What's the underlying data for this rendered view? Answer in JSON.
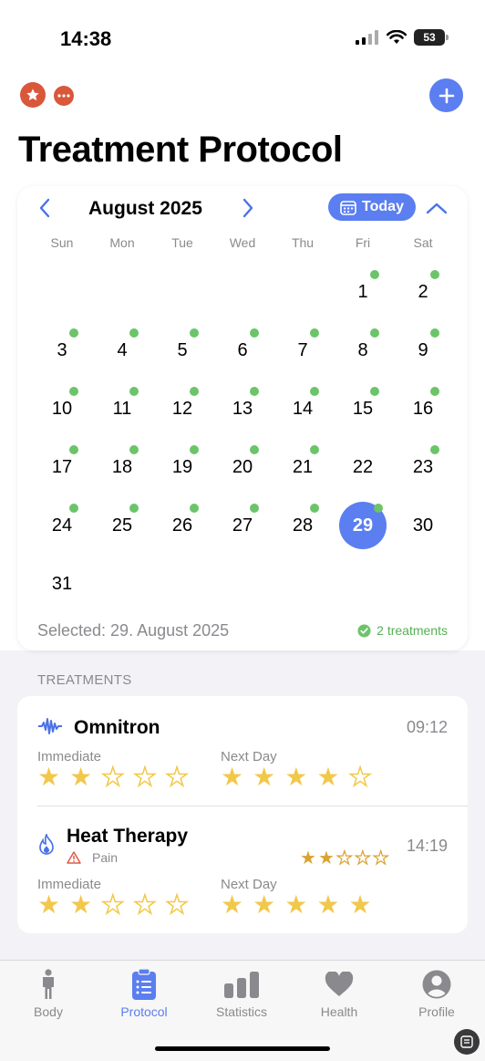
{
  "status_bar": {
    "time": "14:38",
    "battery": "53"
  },
  "header": {
    "title": "Treatment Protocol"
  },
  "calendar": {
    "month": "August 2025",
    "today_label": "Today",
    "weekdays": [
      "Sun",
      "Mon",
      "Tue",
      "Wed",
      "Thu",
      "Fri",
      "Sat"
    ],
    "first_weekday_index": 5,
    "days_in_month": 31,
    "selected_day": 29,
    "days_with_entries": [
      1,
      2,
      3,
      4,
      5,
      6,
      7,
      8,
      9,
      10,
      11,
      12,
      13,
      14,
      15,
      16,
      17,
      18,
      19,
      20,
      21,
      23,
      24,
      25,
      26,
      27,
      28,
      29
    ],
    "selected_text": "Selected: 29. August 2025",
    "treatment_count": "2 treatments",
    "accent_color": "#5b7ef0",
    "entry_dot_color": "#6cc46a"
  },
  "treatments": {
    "section_label": "TREATMENTS",
    "items": [
      {
        "name": "Omnitron",
        "icon": "waveform-icon",
        "time": "09:12",
        "immediate_label": "Immediate",
        "immediate_rating": 2,
        "next_day_label": "Next Day",
        "next_day_rating": 4
      },
      {
        "name": "Heat Therapy",
        "icon": "flame-icon",
        "time": "14:19",
        "tag_label": "Pain",
        "tag_icon": "warning-icon",
        "tag_rating": 2,
        "immediate_label": "Immediate",
        "immediate_rating": 2,
        "next_day_label": "Next Day",
        "next_day_rating": 5
      }
    ]
  },
  "tab_bar": {
    "tabs": [
      {
        "label": "Body",
        "icon": "person-icon"
      },
      {
        "label": "Protocol",
        "icon": "clipboard-icon",
        "active": true
      },
      {
        "label": "Statistics",
        "icon": "bar-chart-icon"
      },
      {
        "label": "Health",
        "icon": "heart-icon"
      },
      {
        "label": "Profile",
        "icon": "profile-icon"
      }
    ]
  }
}
